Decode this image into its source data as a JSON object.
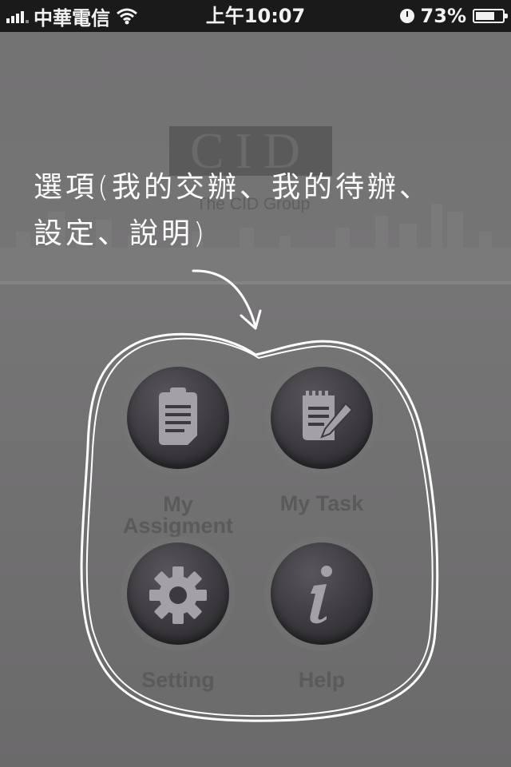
{
  "status_bar": {
    "carrier": "中華電信",
    "time": "上午10:07",
    "battery_percent": "73%",
    "battery_level": 0.73,
    "signal_icon": "signal-bars-icon",
    "wifi_icon": "wifi-icon",
    "clock_icon": "alarm-clock-icon"
  },
  "brand": {
    "logo_text": "CID",
    "logo_subtext": "The CID Group"
  },
  "annotation": {
    "line1": "選項(我的交辦、我的待辦、",
    "line2": "設定、說明)"
  },
  "menu": {
    "items": [
      {
        "label_line1": "My",
        "label_line2": "Assigment",
        "icon": "clipboard-icon"
      },
      {
        "label": "My Task",
        "icon": "notepad-pencil-icon"
      },
      {
        "label": "Setting",
        "icon": "gear-icon"
      },
      {
        "label": "Help",
        "icon": "info-icon"
      }
    ]
  },
  "colors": {
    "overlay_gray": "#6e6d6e",
    "button_dark": "#3c3a3f",
    "annotation_white": "#ffffff"
  }
}
